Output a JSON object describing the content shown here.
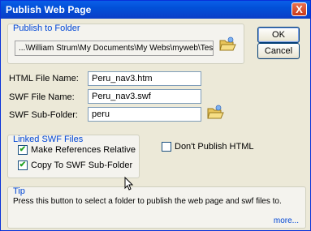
{
  "window": {
    "title": "Publish Web Page",
    "close_label": "X"
  },
  "publish_to_folder": {
    "label": "Publish to Folder",
    "path": "...\\William Strum\\My Documents\\My Webs\\myweb\\Test Pages"
  },
  "buttons": {
    "ok": "OK",
    "cancel": "Cancel"
  },
  "fields": {
    "html_label": "HTML File Name:",
    "html_value": "Peru_nav3.htm",
    "swf_label": "SWF File Name:",
    "swf_value": "Peru_nav3.swf",
    "subfolder_label": "SWF Sub-Folder:",
    "subfolder_value": "peru"
  },
  "linked_swf": {
    "label": "Linked SWF Files",
    "make_relative": {
      "label": "Make References Relative",
      "checked": true
    },
    "copy_to_subfolder": {
      "label": "Copy To SWF Sub-Folder",
      "checked": true
    }
  },
  "dont_publish_html": {
    "label": "Don't Publish HTML",
    "checked": false
  },
  "tip": {
    "label": "Tip",
    "text": "Press this button to select a folder to publish the web page and swf files to.",
    "more": "more..."
  },
  "icons": {
    "folder": "open-folder-icon",
    "cursor": "mouse-pointer-icon"
  }
}
